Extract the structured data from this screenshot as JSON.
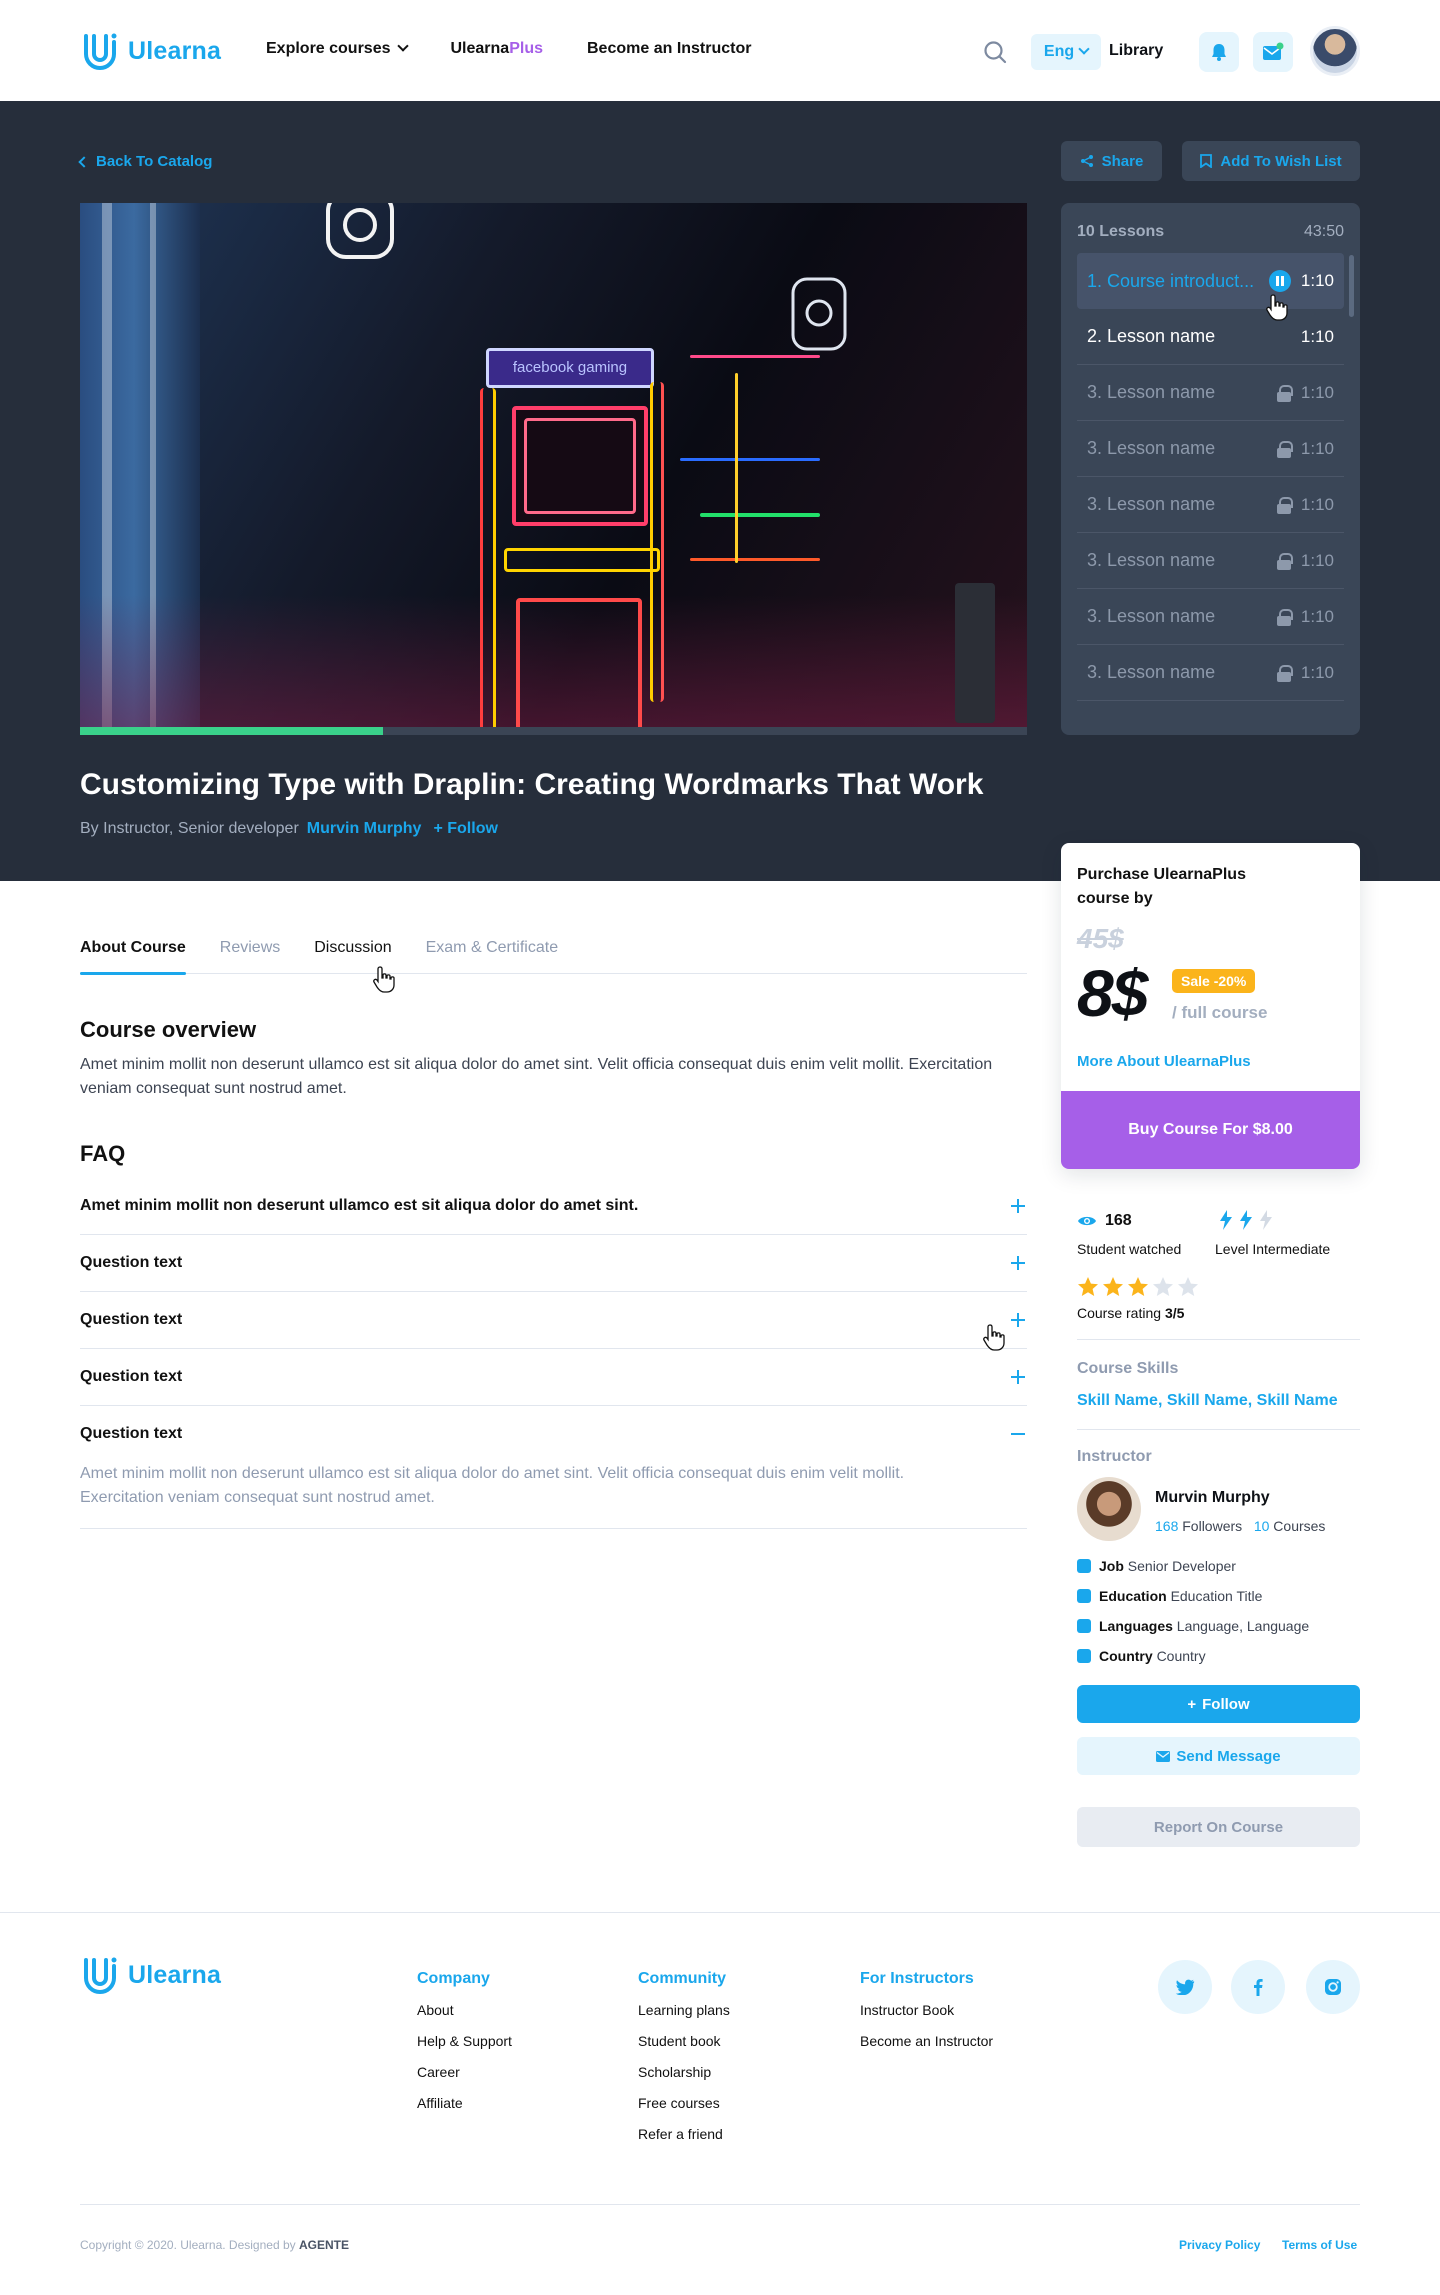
{
  "brand": {
    "name": "Ulearna",
    "accent": "#1aa7ec",
    "plus_color": "#a65fe8"
  },
  "header": {
    "nav": {
      "explore": "Explore courses",
      "plus_a": "Ulearna",
      "plus_b": "Plus",
      "instructor": "Become an Instructor"
    },
    "language": "Eng",
    "library": "Library"
  },
  "hero": {
    "back": "Back To Catalog",
    "share": "Share",
    "wishlist": "Add To Wish List",
    "video_progress": 0.32,
    "video_signage": "facebook gaming",
    "title": "Customizing Type with Draplin: Creating Wordmarks That Work",
    "byline_prefix": "By Instructor, Senior developer",
    "byline_name": "Murvin Murphy",
    "byline_follow": "Follow"
  },
  "lessons": {
    "count": "10 Lessons",
    "total": "43:50",
    "items": [
      {
        "name": "1. Course introduct...",
        "time": "1:10",
        "state": "playing"
      },
      {
        "name": "2. Lesson name",
        "time": "1:10",
        "state": "open"
      },
      {
        "name": "3. Lesson name",
        "time": "1:10",
        "state": "locked"
      },
      {
        "name": "3. Lesson name",
        "time": "1:10",
        "state": "locked"
      },
      {
        "name": "3. Lesson name",
        "time": "1:10",
        "state": "locked"
      },
      {
        "name": "3. Lesson name",
        "time": "1:10",
        "state": "locked"
      },
      {
        "name": "3. Lesson name",
        "time": "1:10",
        "state": "locked"
      },
      {
        "name": "3. Lesson name",
        "time": "1:10",
        "state": "locked"
      }
    ]
  },
  "purchase": {
    "title": "Purchase UlearnaPlus course by",
    "old_price": "45$",
    "price": "8$",
    "sale": "Sale -20%",
    "per": "/ full course",
    "more": "More About UlearnaPlus",
    "buy": "Buy Course For $8.00"
  },
  "tabs": [
    "About Course",
    "Reviews",
    "Discussion",
    "Exam & Certificate"
  ],
  "overview": {
    "heading": "Course overview",
    "text": "Amet minim mollit non deserunt ullamco est sit aliqua dolor do amet sint. Velit officia consequat duis enim velit mollit. Exercitation veniam consequat sunt nostrud amet."
  },
  "faq": {
    "heading": "FAQ",
    "items": [
      {
        "q": "Amet minim mollit non deserunt ullamco est sit aliqua dolor do amet sint.",
        "open": false
      },
      {
        "q": "Question text",
        "open": false
      },
      {
        "q": "Question text",
        "open": false
      },
      {
        "q": "Question text",
        "open": false
      },
      {
        "q": "Question text",
        "open": true,
        "a": "Amet minim mollit non deserunt ullamco est sit aliqua dolor do amet sint. Velit officia consequat duis enim velit mollit. Exercitation veniam consequat sunt nostrud amet."
      }
    ]
  },
  "stats": {
    "watched": "168",
    "watched_label": "Student watched",
    "level_label": "Level Intermediate",
    "level": 2,
    "level_max": 3,
    "rating": 3,
    "rating_max": 5,
    "rating_prefix": "Course rating",
    "rating_text": "3/5"
  },
  "skills": {
    "label": "Course Skills",
    "items": [
      "Skill Name",
      "Skill Name",
      "Skill Name"
    ]
  },
  "instructor": {
    "label": "Instructor",
    "name": "Murvin Murphy",
    "followers_n": "168",
    "followers": "Followers",
    "courses_n": "10",
    "courses": "Courses",
    "details": [
      {
        "k": "Job",
        "v": "Senior Developer",
        "icon": "briefcase-icon"
      },
      {
        "k": "Education",
        "v": "Education Title",
        "icon": "graduation-cap-icon"
      },
      {
        "k": "Languages",
        "v": "Language, Language",
        "icon": "globe-icon"
      },
      {
        "k": "Country",
        "v": "Country",
        "icon": "location-pin-icon"
      }
    ],
    "follow": "Follow",
    "message": "Send Message",
    "report": "Report On Course"
  },
  "footer": {
    "brand": "Ulearna",
    "cols": [
      {
        "title": "Company",
        "links": [
          "About",
          "Help & Support",
          "Career",
          "Affiliate"
        ]
      },
      {
        "title": "Community",
        "links": [
          "Learning plans",
          "Student book",
          "Scholarship",
          "Free courses",
          "Refer a friend"
        ]
      },
      {
        "title": "For Instructors",
        "links": [
          "Instructor Book",
          "Become an Instructor"
        ]
      }
    ],
    "copyright": "Copyright © 2020. Ulearna. Designed by",
    "designer": "AGENTE",
    "privacy": "Privacy Policy",
    "terms": "Terms of Use"
  }
}
